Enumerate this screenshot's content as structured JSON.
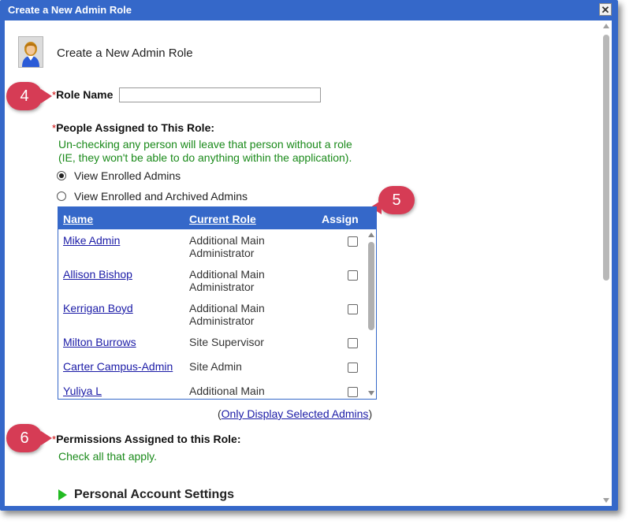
{
  "dialog": {
    "title": "Create a New Admin Role",
    "close_glyph": "✕",
    "header_title": "Create a New Admin Role"
  },
  "callouts": [
    "4",
    "5",
    "6"
  ],
  "role_name": {
    "required_mark": "*",
    "label": "Role Name",
    "value": ""
  },
  "people": {
    "required_mark": "*",
    "label": "People Assigned to This Role:",
    "help_line1": "Un-checking any person will leave that person without a role",
    "help_line2": "(IE, they won't be able to do anything within the application).",
    "radio_options": [
      {
        "label": "View Enrolled Admins",
        "checked": true
      },
      {
        "label": "View Enrolled and Archived Admins",
        "checked": false
      }
    ]
  },
  "admins_table": {
    "columns": [
      "Name",
      "Current Role",
      "Assign"
    ],
    "rows": [
      {
        "name": "Mike Admin",
        "role_line1": "Additional Main",
        "role_line2": "Administrator",
        "assigned": false
      },
      {
        "name": "Allison Bishop",
        "role_line1": "Additional Main",
        "role_line2": "Administrator",
        "assigned": false
      },
      {
        "name": "Kerrigan Boyd",
        "role_line1": "Additional Main",
        "role_line2": "Administrator",
        "assigned": false
      },
      {
        "name": "Milton Burrows",
        "role_line1": "Site Supervisor",
        "role_line2": "",
        "assigned": false
      },
      {
        "name": "Carter Campus-Admin",
        "role_line1": "Site Admin",
        "role_line2": "",
        "assigned": false
      },
      {
        "name": "Yuliya L",
        "role_line1": "Additional Main",
        "role_line2": "",
        "assigned": false
      }
    ],
    "only_display_open": "(",
    "only_display_link": "Only Display Selected Admins",
    "only_display_close": ")"
  },
  "permissions": {
    "required_mark": "*",
    "label": "Permissions Assigned to this Role:",
    "help": "Check all that apply."
  },
  "sections": {
    "personal_account": "Personal Account Settings"
  },
  "colors": {
    "accent": "#3568c9",
    "callout": "#d63c55",
    "help_text": "#1a8a1a",
    "required": "#cc0000",
    "link": "#1a1aa6",
    "expander": "#22bb22"
  }
}
